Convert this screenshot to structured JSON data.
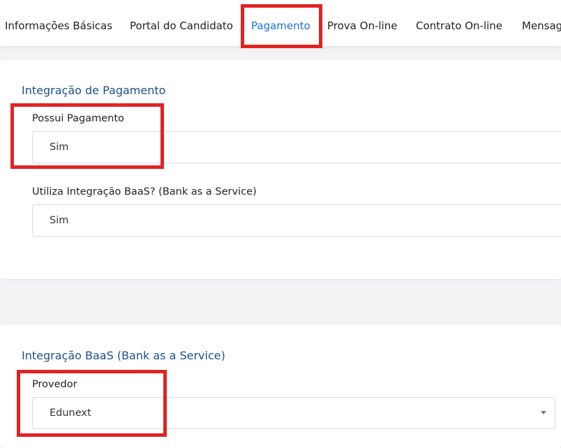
{
  "tabs": [
    {
      "label": "Informações Básicas",
      "active": false
    },
    {
      "label": "Portal do Candidato",
      "active": false
    },
    {
      "label": "Pagamento",
      "active": true
    },
    {
      "label": "Prova On-line",
      "active": false
    },
    {
      "label": "Contrato On-line",
      "active": false
    },
    {
      "label": "Mensag",
      "active": false
    }
  ],
  "payment_integration": {
    "title": "Integração de Pagamento",
    "has_payment": {
      "label": "Possui Pagamento",
      "value": "Sim"
    },
    "uses_baas": {
      "label": "Utiliza Integração BaaS? (Bank as a Service)",
      "value": "Sim"
    }
  },
  "baas_integration": {
    "title": "Integração BaaS (Bank as a Service)",
    "provider": {
      "label": "Provedor",
      "value": "Edunext"
    }
  },
  "colors": {
    "active_tab": "#1a73d9",
    "section_title": "#1d4f8f",
    "highlight": "#e32222"
  }
}
